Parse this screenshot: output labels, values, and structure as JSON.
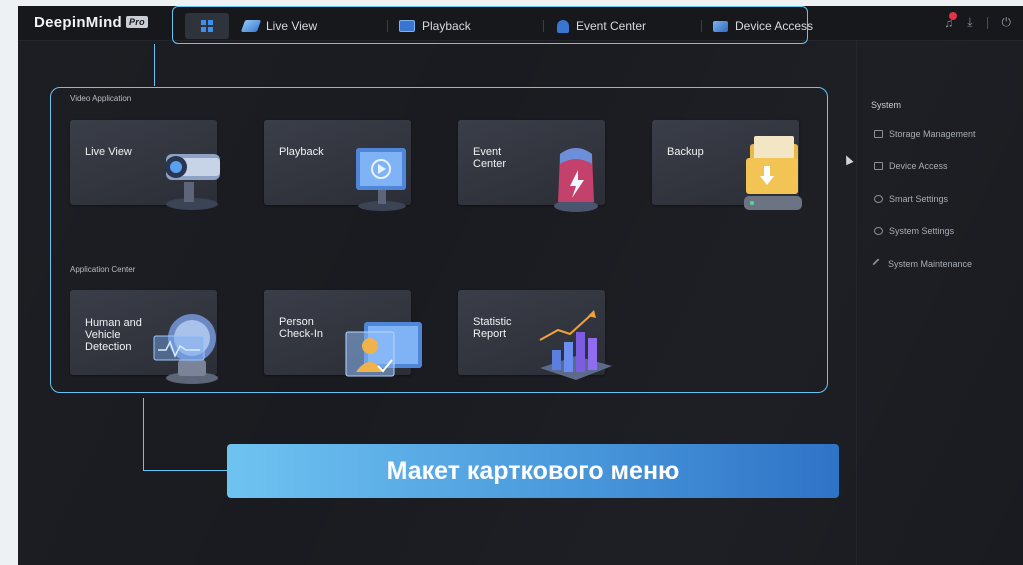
{
  "app": {
    "logo": "DeepinMind",
    "logo_badge": "Pro"
  },
  "nav": {
    "home_icon": "grid-icon",
    "items": [
      {
        "label": "Live View",
        "icon": "camera-icon"
      },
      {
        "label": "Playback",
        "icon": "playback-icon"
      },
      {
        "label": "Event Center",
        "icon": "event-icon"
      },
      {
        "label": "Device Access",
        "icon": "device-icon"
      }
    ]
  },
  "topbar_icons": [
    "alarm-bell-icon",
    "download-icon",
    "power-icon"
  ],
  "sections": {
    "video": {
      "label": "Video Application",
      "cards": [
        {
          "label": "Live View"
        },
        {
          "label": "Playback"
        },
        {
          "label": "Event\nCenter"
        },
        {
          "label": "Backup"
        }
      ]
    },
    "apps": {
      "label": "Application Center",
      "cards": [
        {
          "label": "Human and\nVehicle\nDetection"
        },
        {
          "label": "Person\nCheck-In"
        },
        {
          "label": "Statistic\nReport"
        }
      ]
    }
  },
  "sidebar": {
    "title": "System",
    "items": [
      {
        "label": "Storage Management"
      },
      {
        "label": "Device Access"
      },
      {
        "label": "Smart Settings"
      },
      {
        "label": "System Settings"
      },
      {
        "label": "System Maintenance"
      }
    ]
  },
  "caption": {
    "text": "Макет карткового меню"
  },
  "colors": {
    "highlight": "#69c3f0",
    "accent": "#3d8ff0",
    "background": "#191b20"
  }
}
